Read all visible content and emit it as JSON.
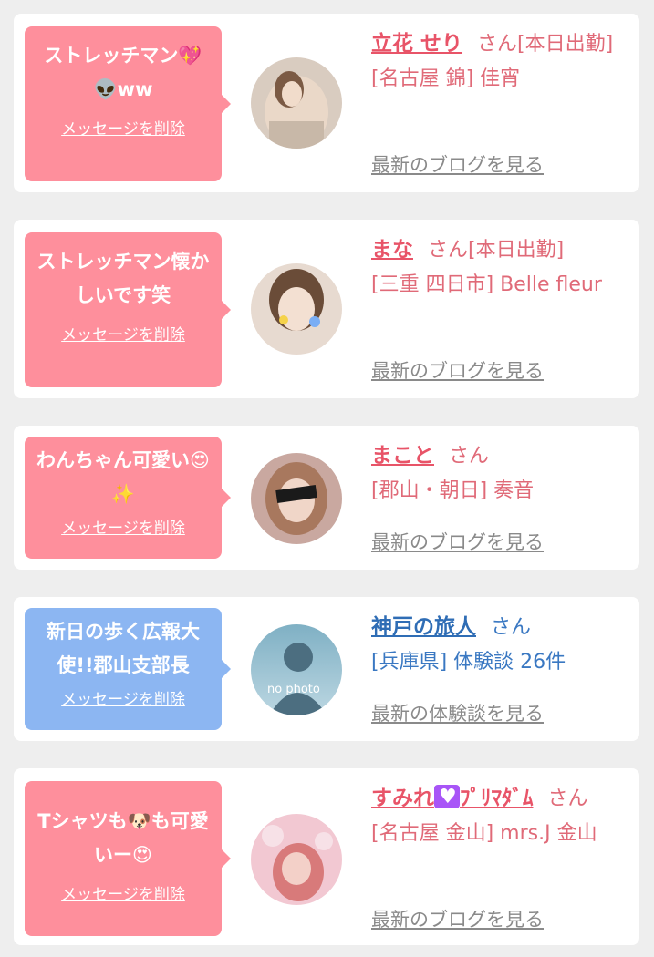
{
  "colors": {
    "card_bg": "#ffffff",
    "page_bg": "#eeeeee",
    "bubble_pink": "#fe8f9c",
    "bubble_blue": "#8cb6f2",
    "name_pink": "#e85468",
    "name_blue": "#2f6db5",
    "meta_gray": "#8a8a8a"
  },
  "items": [
    {
      "message": "ストレッチマン💖👽ww",
      "delete_label": "メッセージを削除",
      "name": "立花 せり",
      "suffix": "さん[本日出勤]",
      "place": "[名古屋 錦] 佳宵",
      "link": "最新のブログを見る"
    },
    {
      "message": "ストレッチマン懐かしいです笑",
      "delete_label": "メッセージを削除",
      "name": "まな",
      "suffix": "さん[本日出勤]",
      "place": "[三重 四日市] Belle fleur",
      "link": "最新のブログを見る"
    },
    {
      "message": "わんちゃん可愛い😍✨",
      "delete_label": "メッセージを削除",
      "name": "まこと",
      "suffix": "さん",
      "place": "[郡山・朝日] 奏音",
      "link": "最新のブログを見る"
    },
    {
      "message": "新日の歩く広報大使!!郡山支部長",
      "delete_label": "メッセージを削除",
      "name": "神戸の旅人",
      "suffix": "さん",
      "place": "[兵庫県] 体験談 26件",
      "link": "最新の体験談を見る",
      "avatar_text": "no photo"
    },
    {
      "message": "Tシャツも🐶も可愛いー😍",
      "delete_label": "メッセージを削除",
      "name_main": "すみれ",
      "name_tail": "ﾌﾟﾘﾏﾀﾞﾑ",
      "suffix": "さん",
      "place": "[名古屋 金山] mrs.J 金山",
      "link": "最新のブログを見る"
    }
  ]
}
